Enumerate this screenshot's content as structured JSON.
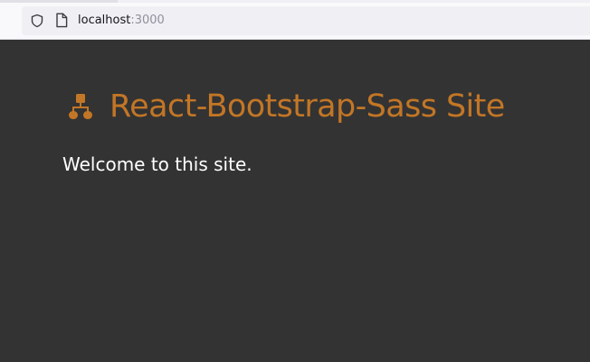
{
  "browser": {
    "url_host": "localhost",
    "url_port": ":3000",
    "security_icon": "shield-icon",
    "page_icon": "page-icon"
  },
  "page": {
    "title": "React-Bootstrap-Sass Site",
    "title_icon": "sitemap-icon",
    "welcome": "Welcome to this site."
  },
  "colors": {
    "background": "#333333",
    "accent": "#c27626",
    "text": "#ffffff"
  }
}
